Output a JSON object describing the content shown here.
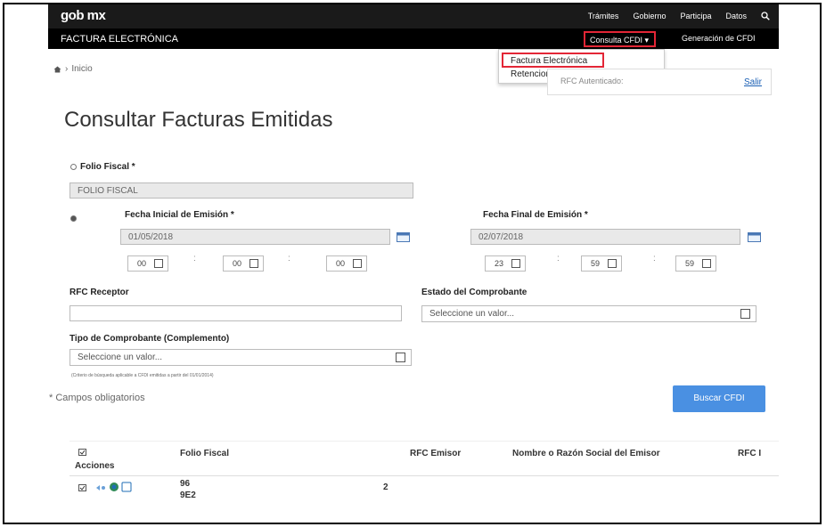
{
  "topbar": {
    "brand": "gob mx",
    "nav": [
      "Trámites",
      "Gobierno",
      "Participa",
      "Datos"
    ]
  },
  "subbar": {
    "title": "FACTURA ELECTRÓNICA",
    "consulta_label": "Consulta CFDI",
    "generacion_label": "Generación de CFDI"
  },
  "dropdown": {
    "items": [
      "Factura Electrónica",
      "Retenciones e inf. de Pagos"
    ]
  },
  "breadcrumb": {
    "label": "Inicio"
  },
  "session": {
    "text": "RFC Autenticado:",
    "logout": "Salir"
  },
  "page_title": "Consultar Facturas Emitidas",
  "form": {
    "folio_label": "Folio Fiscal *",
    "folio_placeholder": "FOLIO FISCAL",
    "fecha_inicial_label": "Fecha Inicial de Emisión *",
    "fecha_inicial_value": "01/05/2018",
    "fecha_inicial_time": [
      "00",
      "00",
      "00"
    ],
    "fecha_final_label": "Fecha Final de Emisión *",
    "fecha_final_value": "02/07/2018",
    "fecha_final_time": [
      "23",
      "59",
      "59"
    ],
    "rfc_receptor_label": "RFC Receptor",
    "rfc_receptor_value": "",
    "estado_label": "Estado del Comprobante",
    "estado_value": "Seleccione un valor...",
    "tipo_label": "Tipo de Comprobante (Complemento)",
    "tipo_value": "Seleccione un valor...",
    "hint": "(Criterio de búsqueda aplicable a CFDI emitidas a partir del 01/01/2014)",
    "required_note": "* Campos obligatorios",
    "search_button": "Buscar CFDI"
  },
  "table": {
    "headers": [
      "Acciones",
      "Folio Fiscal",
      "RFC Emisor",
      "Nombre o Razón Social del Emisor",
      "RFC I"
    ],
    "rows": [
      {
        "folio_line1": "96",
        "folio_line2": "9E2",
        "rfc_emisor": "2"
      }
    ]
  },
  "colors": {
    "topbar": "#1a1a1a",
    "subbar": "#000000",
    "highlight": "#e32636",
    "button": "#4a90e2"
  }
}
